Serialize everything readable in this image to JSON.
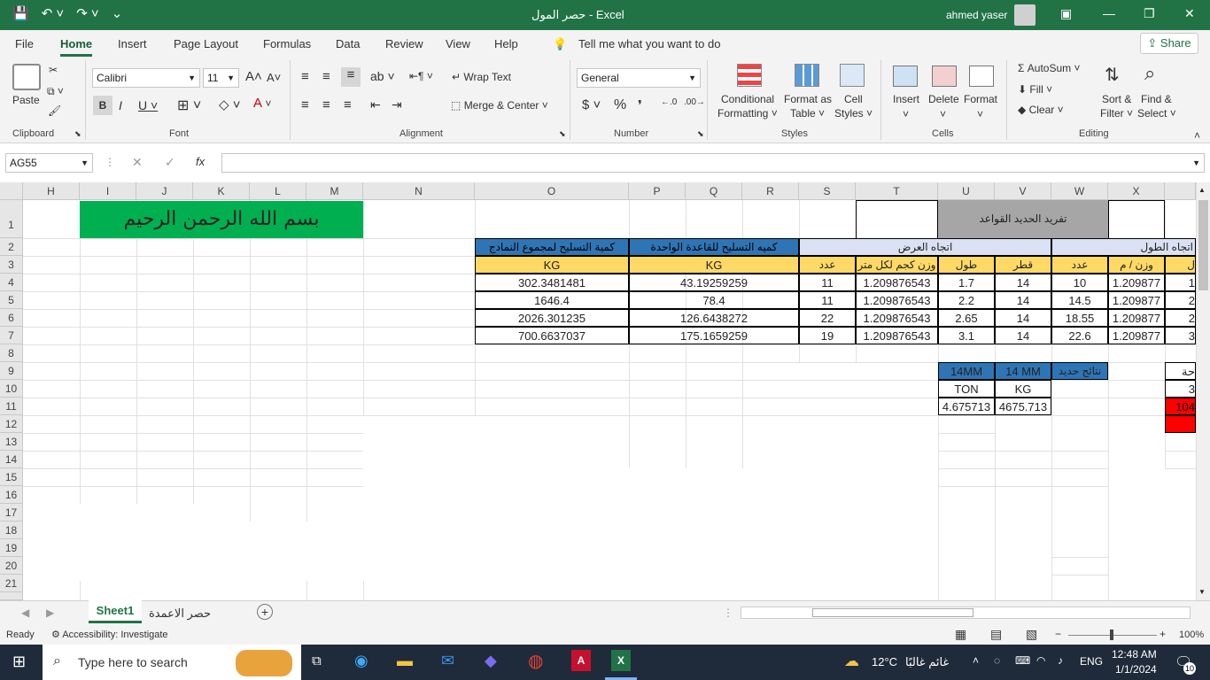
{
  "titlebar": {
    "title": "حصر المول  -  Excel",
    "user": "ahmed yaser"
  },
  "tabs": [
    "File",
    "Home",
    "Insert",
    "Page Layout",
    "Formulas",
    "Data",
    "Review",
    "View",
    "Help"
  ],
  "tell_me": "Tell me what you want to do",
  "share": "Share",
  "ribbon": {
    "clipboard": {
      "label": "Clipboard",
      "paste": "Paste"
    },
    "font": {
      "label": "Font",
      "name": "Calibri",
      "size": "11"
    },
    "alignment": {
      "label": "Alignment",
      "wrap": "Wrap Text",
      "merge": "Merge & Center"
    },
    "number": {
      "label": "Number",
      "format": "General"
    },
    "styles": {
      "label": "Styles",
      "conditional": "Conditional",
      "conditional2": "Formatting",
      "format_table": "Format as",
      "format_table2": "Table",
      "cell_styles": "Cell",
      "cell_styles2": "Styles"
    },
    "cells": {
      "label": "Cells",
      "insert": "Insert",
      "delete": "Delete",
      "format": "Format"
    },
    "editing": {
      "label": "Editing",
      "autosum": "AutoSum",
      "fill": "Fill",
      "clear": "Clear",
      "sort": "Sort &",
      "sort2": "Filter",
      "find": "Find &",
      "find2": "Select"
    }
  },
  "namebox": "AG55",
  "columns": [
    "H",
    "I",
    "J",
    "K",
    "L",
    "M",
    "N",
    "O",
    "P",
    "Q",
    "R",
    "S",
    "T",
    "U",
    "V",
    "W",
    "X"
  ],
  "rows": [
    "1",
    "2",
    "3",
    "4",
    "5",
    "6",
    "7",
    "8",
    "9",
    "10",
    "11",
    "12",
    "13",
    "14",
    "15",
    "16",
    "17",
    "18",
    "19",
    "20",
    "21"
  ],
  "sheet": {
    "basmala": "بسم الله الرحمن الرحيم",
    "title_u1": "تفريد الحديد القواعد",
    "hdr_total": "كمية التسليح لمجموع النمادج",
    "hdr_single": "كميه التسليح للقاعدة الواحدة",
    "hdr_width": "اتجاه العرض",
    "hdr_length": "اتجاه الطول",
    "unit_kg": "KG",
    "sub_count": "عدد",
    "sub_weight": "وزن كجم لكل متر",
    "sub_len": "طول",
    "sub_dia": "قطر",
    "sub_weight2": "وزن / م",
    "rows": [
      [
        "302.3481481",
        "43.19259259",
        "11",
        "1.209876543",
        "1.7",
        "14",
        "10",
        "1.209877",
        "1"
      ],
      [
        "1646.4",
        "78.4",
        "11",
        "1.209876543",
        "2.2",
        "14",
        "14.5",
        "1.209877",
        "2"
      ],
      [
        "2026.301235",
        "126.6438272",
        "22",
        "1.209876543",
        "2.65",
        "14",
        "18.55",
        "1.209877",
        "2"
      ],
      [
        "700.6637037",
        "175.1659259",
        "19",
        "1.209876543",
        "3.1",
        "14",
        "22.6",
        "1.209877",
        "3"
      ]
    ],
    "res_14mm": "14MM",
    "res_14mm2": "14 MM",
    "res_title": "نتائج حديد",
    "res_ton": "TON",
    "res_kg": "KG",
    "res_ton_val": "4.675713",
    "res_kg_val": "4675.713",
    "x_partial_hdr": "حة",
    "x_partial_3": "3",
    "x_partial_red": "104"
  },
  "sheet_tabs": [
    "Sheet1",
    "حصر الاعمدة"
  ],
  "status": {
    "ready": "Ready",
    "accessibility": "Accessibility: Investigate",
    "zoom": "100%"
  },
  "taskbar": {
    "search": "Type here to search",
    "temp": "12°C",
    "weather": "غائم غالبًا",
    "lang": "ENG",
    "time": "12:48 AM",
    "date": "1/1/2024",
    "badge": "10"
  },
  "colors": {
    "excel_green": "#217346",
    "blue_header": "#2e75b6",
    "yellow": "#ffd966",
    "green_title": "#00b050",
    "gray_title": "#a6a6a6",
    "light_blue": "#d9e1f2",
    "red": "#ff0000"
  }
}
